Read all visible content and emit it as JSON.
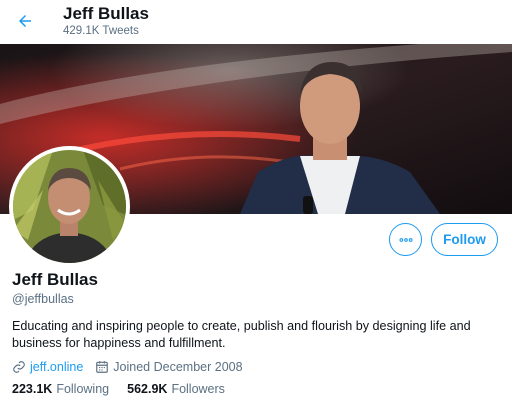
{
  "header": {
    "title": "Jeff Bullas",
    "tweet_count": "429.1K Tweets"
  },
  "profile": {
    "name": "Jeff Bullas",
    "handle": "@jeffbullas",
    "bio": "Educating and inspiring people to create, publish and flourish by designing life and business for happiness and fulfillment.",
    "website": "jeff.online",
    "joined": "Joined December 2008",
    "following_count": "223.1K",
    "following_label": "Following",
    "followers_count": "562.9K",
    "followers_label": "Followers"
  },
  "actions": {
    "follow_label": "Follow"
  },
  "colors": {
    "accent": "#1d9bf0",
    "secondary_text": "#5b7083"
  },
  "icons": [
    "back-arrow-icon",
    "more-icon",
    "link-icon",
    "calendar-icon"
  ]
}
